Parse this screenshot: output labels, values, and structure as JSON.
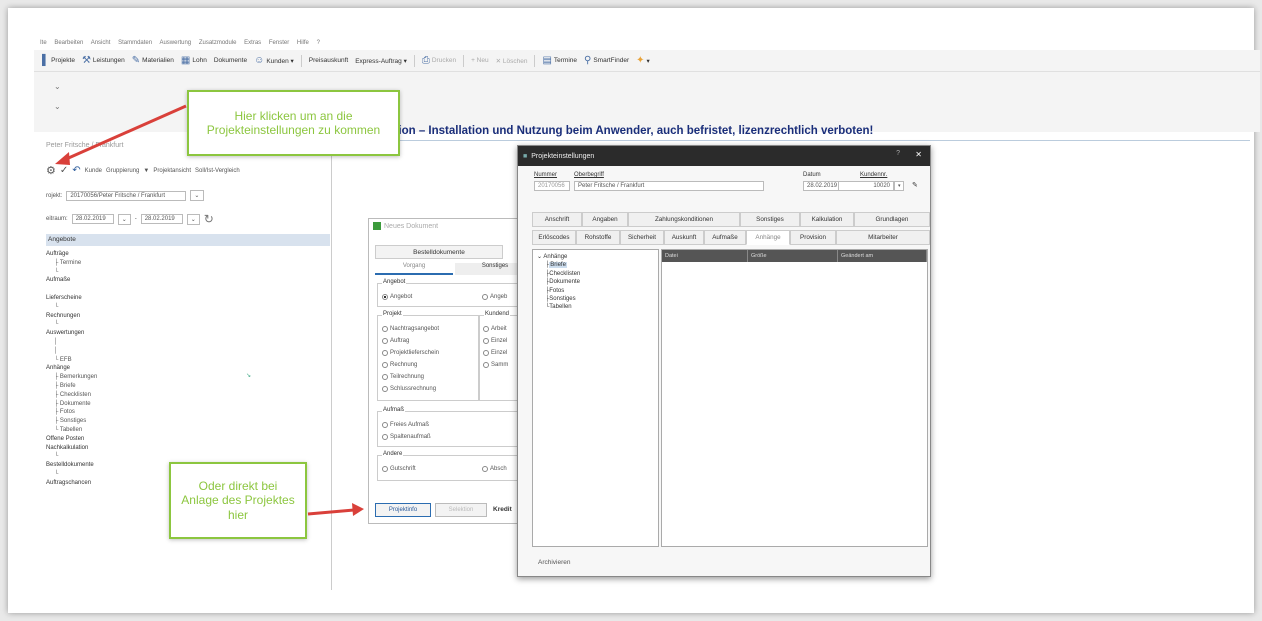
{
  "menubar": {
    "items": [
      "Ite",
      "Bearbeiten",
      "Ansicht",
      "Stammdaten",
      "Auswertung",
      "Zusatzmodule",
      "Extras",
      "Fenster",
      "Hilfe",
      "?"
    ]
  },
  "toolbar": {
    "items": [
      {
        "label": "Projekte",
        "icon": "projects-icon"
      },
      {
        "label": "Leistungen",
        "icon": "services-icon"
      },
      {
        "label": "Materialien",
        "icon": "materials-icon"
      },
      {
        "label": "Lohn",
        "icon": "wage-icon"
      },
      {
        "label": "Dokumente",
        "icon": ""
      },
      {
        "label": "Kunden ▾",
        "icon": "customers-icon"
      },
      {
        "label": "Preisauskunft",
        "icon": ""
      },
      {
        "label": "Express-Auftrag ▾",
        "icon": ""
      },
      {
        "label": "Drucken",
        "icon": "print-icon"
      },
      {
        "label": "+ Neu",
        "icon": ""
      },
      {
        "label": "✕ Löschen",
        "icon": ""
      },
      {
        "label": "Termine",
        "icon": "calendar-icon"
      },
      {
        "label": "SmartFinder",
        "icon": "search-icon"
      }
    ]
  },
  "headline": "sion – Installation und Nutzung beim Anwender, auch befristet, lizenzrechtlich verboten!",
  "left_panel": {
    "title": "Peter Fritsche / Frankfurt",
    "toolbar": {
      "kunde": "Kunde",
      "gruppierung": "Gruppierung",
      "projektansicht": "Projektansicht",
      "soll_ist": "Soll/Ist-Vergleich"
    },
    "projekt_label": "rojekt:",
    "projekt_value": "20170056/Peter Fritsche / Frankfurt",
    "zeitraum_label": "eitraum:",
    "date_from": "28.02.2019",
    "date_to": "28.02.2019",
    "selected": "Angebote",
    "tree": [
      {
        "text": "Aufträge",
        "level": 0
      },
      {
        "text": "Termine",
        "level": 1
      },
      {
        "text": "Aufmaße",
        "level": 0
      },
      {
        "text": "Lieferscheine",
        "level": 0
      },
      {
        "text": "Rechnungen",
        "level": 0
      },
      {
        "text": "Auswertungen",
        "level": 0
      },
      {
        "text": "EFB",
        "level": 1
      },
      {
        "text": "Anhänge",
        "level": 0
      },
      {
        "text": "Bemerkungen",
        "level": 1
      },
      {
        "text": "Briefe",
        "level": 1
      },
      {
        "text": "Checklisten",
        "level": 1
      },
      {
        "text": "Dokumente",
        "level": 1
      },
      {
        "text": "Fotos",
        "level": 1
      },
      {
        "text": "Sonstiges",
        "level": 1
      },
      {
        "text": "Tabellen",
        "level": 1
      },
      {
        "text": "Offene Posten",
        "level": 0
      },
      {
        "text": "Nachkalkulation",
        "level": 0
      },
      {
        "text": "Bestelldokumente",
        "level": 0
      },
      {
        "text": "Auftragschancen",
        "level": 0
      }
    ]
  },
  "neues_dokument": {
    "title": "Neues Dokument",
    "tab1": "Bestelldokumente",
    "sub1": "Vorgang",
    "sub2": "Sonstiges",
    "grp_angebot": "Angebot",
    "angebot": "Angebot",
    "angebot2": "Angeb",
    "grp_projekt": "Projekt",
    "grp_kunden": "Kundend",
    "projekt_options": [
      "Nachtragsangebot",
      "Auftrag",
      "Projektlieferschein",
      "Rechnung",
      "Teilrechnung",
      "Schlussrechnung"
    ],
    "kunden_options": [
      "Arbeit",
      "Einzel",
      "Einzel",
      "Samm"
    ],
    "grp_aufmass": "Aufmaß",
    "aufmass_options": [
      "Freies Aufmaß",
      "Spaltenaufmaß"
    ],
    "grp_andere": "Andere",
    "gutschrift": "Gutschrift",
    "absch": "Absch",
    "btn_projektinfo": "Projektinfo",
    "btn_selektion": "Selektion",
    "kredit": "Kredit"
  },
  "projekteinstellungen": {
    "title": "Projekteinstellungen",
    "q": "?",
    "close": "✕",
    "nummer_label": "Nummer",
    "nummer": "20170056",
    "oberbegriff_label": "Oberbegriff",
    "oberbegriff": "Peter Fritsche / Frankfurt",
    "datum_label": "Datum",
    "datum": "28.02.2019",
    "kundennr_label": "Kundennr.",
    "kundennr": "10020",
    "tabs_row1": [
      "Anschrift",
      "Angaben",
      "Zahlungskonditionen",
      "Sonstiges",
      "Kalkulation",
      "Grundlagen"
    ],
    "tabs_row2": [
      "Erlöscodes",
      "Rohstoffe",
      "Sicherheit",
      "Auskunft",
      "Aufmaße",
      "Anhänge",
      "Provision",
      "Mitarbeiter"
    ],
    "active_tab": "Anhänge",
    "tree_root": "Anhänge",
    "tree_children": [
      "Briefe",
      "Checklisten",
      "Dokumente",
      "Fotos",
      "Sonstiges",
      "Tabellen"
    ],
    "columns": [
      "Datei",
      "Größe",
      "Geändert am"
    ],
    "archivieren": "Archivieren"
  },
  "callouts": {
    "top": "Hier klicken um an die Projekteinstellungen zu kommen",
    "bottom": "Oder direkt bei Anlage des Projektes hier"
  },
  "colors": {
    "callout": "#8cc63f",
    "arrow": "#d9403a",
    "headline": "#1a2e7a",
    "titlebar": "#2b2b2b"
  }
}
